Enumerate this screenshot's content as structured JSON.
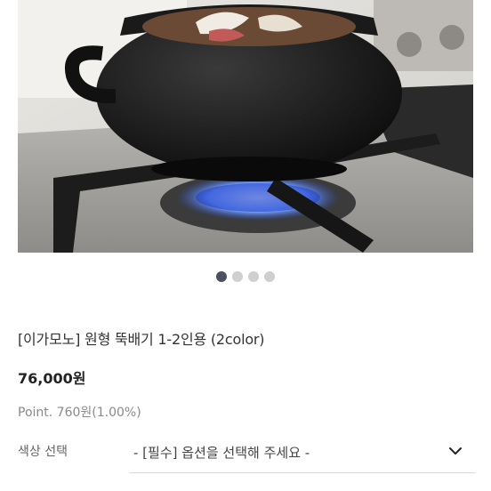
{
  "carousel": {
    "total_slides": 4,
    "active_slide": 1
  },
  "product": {
    "title": "[이가모노] 원형 뚝배기 1-2인용 (2color)",
    "price": "76,000원",
    "points": "Point. 760원(1.00%)"
  },
  "options": {
    "color_label": "색상 선택",
    "color_placeholder": "- [필수] 옵션을 선택해 주세요 -"
  },
  "colors": {
    "active_dot": "#4b5060",
    "inactive_dot": "#cfcfcf"
  }
}
